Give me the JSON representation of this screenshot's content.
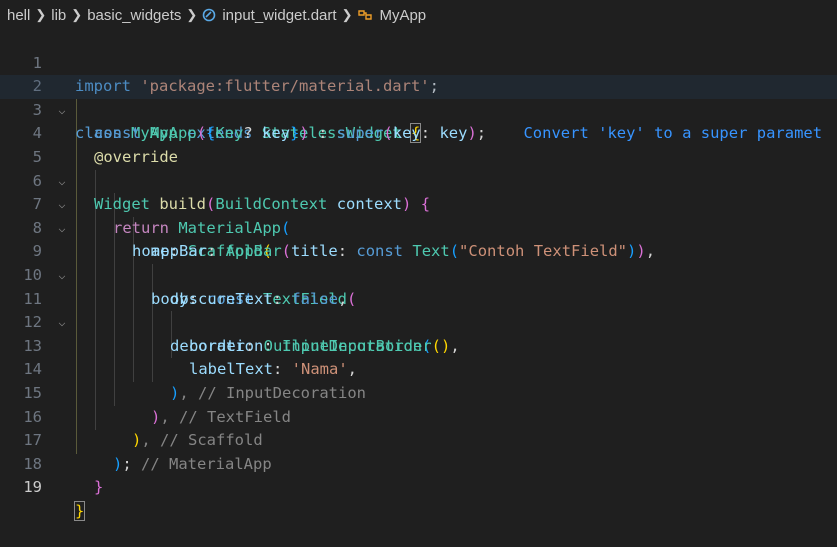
{
  "breadcrumb": {
    "items": [
      "hell",
      "lib",
      "basic_widgets",
      "input_widget.dart",
      "MyApp"
    ]
  },
  "editor": {
    "lines": [
      {
        "n": "1"
      },
      {
        "n": "2"
      },
      {
        "n": "3"
      },
      {
        "n": "4"
      },
      {
        "n": "5"
      },
      {
        "n": "6"
      },
      {
        "n": "7"
      },
      {
        "n": "8"
      },
      {
        "n": "9"
      },
      {
        "n": "10"
      },
      {
        "n": "11"
      },
      {
        "n": "12"
      },
      {
        "n": "13"
      },
      {
        "n": "14"
      },
      {
        "n": "15"
      },
      {
        "n": "16"
      },
      {
        "n": "17"
      },
      {
        "n": "18"
      },
      {
        "n": "19"
      }
    ],
    "t": {
      "l1_import": "import",
      "l1_str": "'package:flutter/material.dart'",
      "l1_semi": ";",
      "l2_class": "class",
      "l2_name": "MyApp",
      "l2_extends": "extends",
      "l2_super": "StatelessWidget",
      "l2_brace": "{",
      "l3_const": "const",
      "l3_name": "MyApp",
      "l3_p1": "(",
      "l3_b1": "{",
      "l3_key_t": "Key",
      "l3_q": "?",
      "l3_key": "key",
      "l3_b2": "}",
      "l3_p2": ")",
      "l3_colon": " : ",
      "l3_super": "super",
      "l3_p3": "(",
      "l3_key2": "key",
      "l3_c2": ": ",
      "l3_key3": "key",
      "l3_p4": ")",
      "l3_semi": ";",
      "l3_hint": "Convert 'key' to a super paramet",
      "l4_override": "@override",
      "l5_widget": "Widget",
      "l5_build": "build",
      "l5_p1": "(",
      "l5_ctx_t": "BuildContext",
      "l5_ctx": "context",
      "l5_p2": ")",
      "l5_brace": "{",
      "l6_return": "return",
      "l6_material": "MaterialApp",
      "l6_p": "(",
      "l7_home": "home",
      "l7_colon": ": ",
      "l7_scaffold": "Scaffold",
      "l7_p": "(",
      "l8_appbar": "appBar",
      "l8_colon": ": ",
      "l8_appbar_t": "AppBar",
      "l8_p1": "(",
      "l8_title": "title",
      "l8_c2": ": ",
      "l8_const": "const",
      "l8_text": "Text",
      "l8_p2": "(",
      "l8_str": "\"Contoh TextField\"",
      "l8_p3": ")",
      "l8_p4": ")",
      "l8_comma": ",",
      "l9_body": "body",
      "l9_colon": ": ",
      "l9_const": "const",
      "l9_tf": "TextField",
      "l9_p": "(",
      "l10_obs": "obscureText",
      "l10_colon": ": ",
      "l10_false": "false",
      "l10_comma": ",",
      "l11_dec": "decoration",
      "l11_colon": ": ",
      "l11_input": "InputDecoration",
      "l11_p": "(",
      "l12_border": "border",
      "l12_colon": ": ",
      "l12_oib": "OutlineInputBorder",
      "l12_p1": "(",
      "l12_p2": ")",
      "l12_comma": ",",
      "l13_label": "labelText",
      "l13_colon": ": ",
      "l13_str": "'Nama'",
      "l13_comma": ",",
      "l14_p": ")",
      "l14_rest": ", // InputDecoration",
      "l15_p": ")",
      "l15_rest": ", // TextField",
      "l16_p": ")",
      "l16_rest": ", // Scaffold",
      "l17_p": ")",
      "l17_semi": ";",
      "l17_cm": " // MaterialApp",
      "l18_brace": "}",
      "l19_brace": "}"
    }
  }
}
